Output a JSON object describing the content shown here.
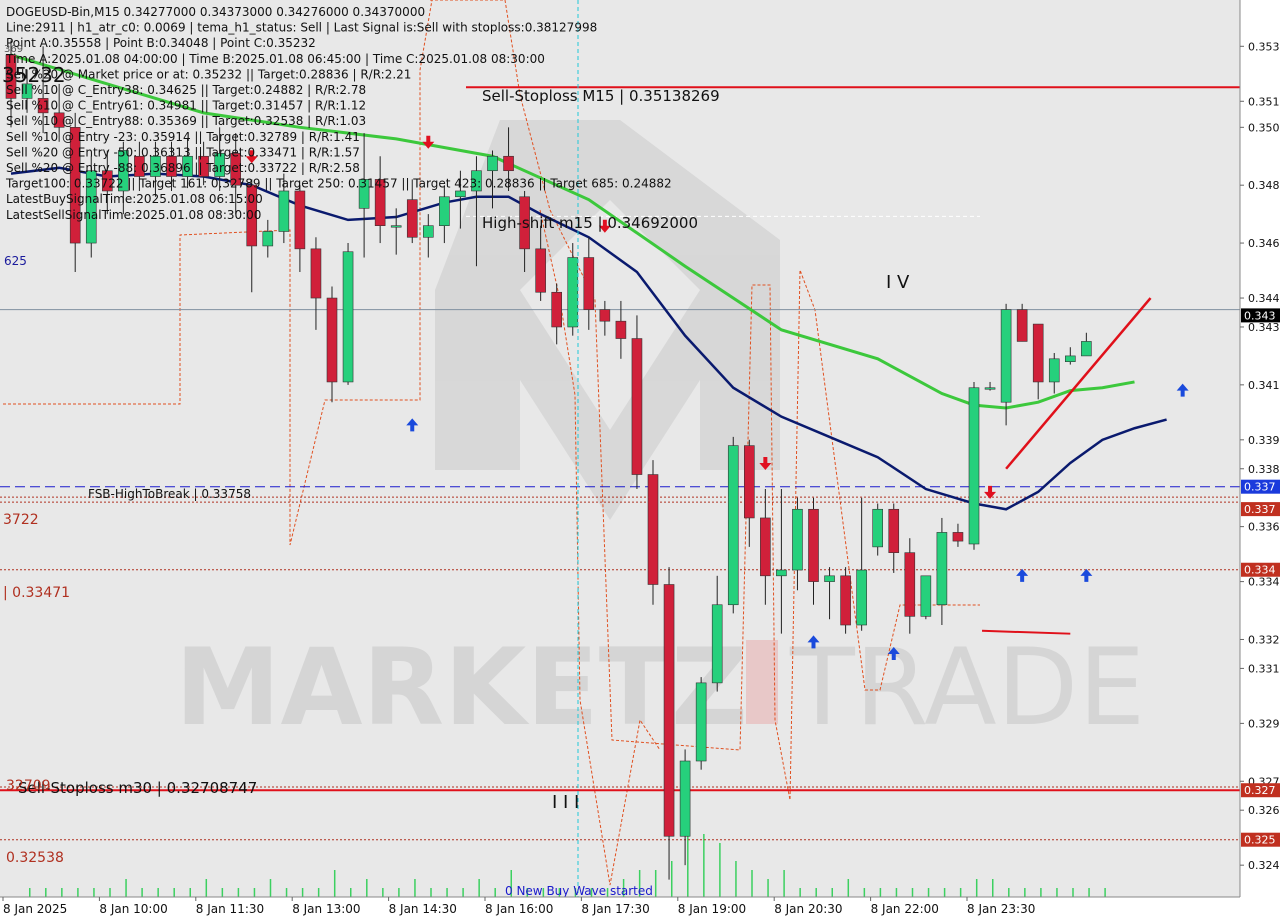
{
  "header": {
    "lines": [
      "DOGEUSD-Bin,M15  0.34277000 0.34373000 0.34276000 0.34370000",
      "Line:2911 | h1_atr_c0: 0.0069 | tema_h1_status: Sell | Last Signal is:Sell with stoploss:0.38127998",
      "Point A:0.35558 | Point B:0.34048 | Point C:0.35232",
      "Time A:2025.01.08 04:00:00 | Time B:2025.01.08 06:45:00 | Time C:2025.01.08 08:30:00",
      "Sell %20 @ Market price or at: 0.35232 || Target:0.28836 | R/R:2.21",
      "Sell %10 @ C_Entry38: 0.34625 || Target:0.24882 | R/R:2.78",
      "Sell %10 @ C_Entry61: 0.34981 || Target:0.31457 | R/R:1.12",
      "Sell %10 @ C_Entry88: 0.35369 || Target:0.32538 | R/R:1.03",
      "Sell %10 @ Entry -23: 0.35914 || Target:0.32789 | R/R:1.41",
      "Sell %20 @ Entry -50: 0.36313 || Target:0.33471 | R/R:1.57",
      "Sell %20 @ Entry -88: 0.36896 || Target:0.33722 | R/R:2.58",
      "Target100: 0.33722 || Target 161: 0.32789 || Target 250: 0.31457 || Target 423: 0.28836 || Target 685: 0.24882",
      "LatestBuySignalTime:2025.01.08 06:15:00",
      "LatestSellSignalTime:2025.01.08 08:30:00"
    ],
    "corner_overlay": "35232",
    "corner_tiny_1": "369",
    "left_edge_label": "625"
  },
  "annotations": {
    "sell_stoploss_m15": "Sell-Stoploss M15 | 0.35138269",
    "high_shift": "High-shift m15 | 0.34692000",
    "fsb_high": "FSB-HighToBreak | 0.33758",
    "sell_stoploss_m30": "Sell-Stoploss m30 | 0.32708747",
    "wave_iv": "I V",
    "wave_iii": "I I I",
    "new_buy_wave": "0 New Buy Wave started",
    "left_3722": "3722",
    "left_33471": "| 0.33471",
    "left_32538": "0.32538",
    "left_32709": "32709"
  },
  "watermark": {
    "left": "MARKETZ",
    "i": "I",
    "right": "TRADE"
  },
  "colors": {
    "bull": "#26d07c",
    "bear": "#d0203a",
    "ma_fast": "#0a1a6e",
    "ma_slow": "#3cc83c",
    "stop_line": "#e0101a",
    "fsb_line": "#1a1acc",
    "dotted_red": "#b03020",
    "envelope": "#e05020",
    "cyan": "#20c8d8",
    "volume": "#3cd060"
  },
  "chart_data": {
    "type": "candlestick",
    "symbol": "DOGEUSD-Bin",
    "timeframe": "M15",
    "ylim": [
      0.3234,
      0.3544
    ],
    "x_ticks": [
      "8 Jan 2025",
      "8 Jan 10:00",
      "8 Jan 11:30",
      "8 Jan 13:00",
      "8 Jan 14:30",
      "8 Jan 16:00",
      "8 Jan 17:30",
      "8 Jan 19:00",
      "8 Jan 20:30",
      "8 Jan 22:00",
      "8 Jan 23:30"
    ],
    "y_ticks": [
      "0.353",
      "0.351",
      "0.350",
      "0.348",
      "0.346",
      "0.344",
      "0.343",
      "0.341",
      "0.339",
      "0.338",
      "0.336",
      "0.334",
      "0.332",
      "0.331",
      "0.329",
      "0.327",
      "0.326",
      "0.324"
    ],
    "price_tags": [
      {
        "label": "0.343",
        "value": 0.3435,
        "style": "current"
      },
      {
        "label": "0.337",
        "value": 0.33758,
        "style": "blue"
      },
      {
        "label": "0.337",
        "value": 0.33722,
        "style": "red"
      },
      {
        "label": "0.334",
        "value": 0.33471,
        "style": "red"
      },
      {
        "label": "0.327",
        "value": 0.32709,
        "style": "red"
      },
      {
        "label": "0.325",
        "value": 0.32538,
        "style": "red"
      }
    ],
    "current_price": 0.3437,
    "levels": {
      "sell_stoploss_m15": 0.35138269,
      "high_shift": 0.34692,
      "fsb_high": 0.33758,
      "t100": 0.33722,
      "t_33471": 0.33471,
      "sell_stoploss_m30": 0.32708747,
      "t_32538": 0.32538
    },
    "candles": [
      [
        0.3525,
        0.353,
        0.35,
        0.351
      ],
      [
        0.351,
        0.352,
        0.3505,
        0.3515
      ],
      [
        0.351,
        0.3528,
        0.3498,
        0.3505
      ],
      [
        0.3505,
        0.3515,
        0.3495,
        0.35
      ],
      [
        0.35,
        0.3505,
        0.345,
        0.346
      ],
      [
        0.346,
        0.349,
        0.3455,
        0.3485
      ],
      [
        0.3485,
        0.3492,
        0.347,
        0.3478
      ],
      [
        0.3478,
        0.3495,
        0.347,
        0.3492
      ],
      [
        0.349,
        0.3495,
        0.3478,
        0.3483
      ],
      [
        0.3483,
        0.3495,
        0.3476,
        0.349
      ],
      [
        0.349,
        0.3495,
        0.3478,
        0.3483
      ],
      [
        0.3483,
        0.3496,
        0.3479,
        0.349
      ],
      [
        0.349,
        0.3495,
        0.348,
        0.3483
      ],
      [
        0.3483,
        0.35,
        0.3478,
        0.3491
      ],
      [
        0.3491,
        0.3498,
        0.347,
        0.348
      ],
      [
        0.348,
        0.3482,
        0.3443,
        0.3459
      ],
      [
        0.3459,
        0.3468,
        0.3455,
        0.3464
      ],
      [
        0.3464,
        0.3484,
        0.346,
        0.3478
      ],
      [
        0.3478,
        0.348,
        0.345,
        0.3458
      ],
      [
        0.3458,
        0.3462,
        0.343,
        0.3441
      ],
      [
        0.3441,
        0.3445,
        0.3405,
        0.3412
      ],
      [
        0.3412,
        0.346,
        0.3411,
        0.3457
      ],
      [
        0.3472,
        0.3498,
        0.3455,
        0.3482
      ],
      [
        0.3482,
        0.349,
        0.346,
        0.3466
      ],
      [
        0.3466,
        0.3472,
        0.3456,
        0.3466
      ],
      [
        0.3475,
        0.3482,
        0.346,
        0.3462
      ],
      [
        0.3462,
        0.347,
        0.3455,
        0.3466
      ],
      [
        0.3466,
        0.348,
        0.346,
        0.3476
      ],
      [
        0.3476,
        0.3485,
        0.3465,
        0.3478
      ],
      [
        0.3478,
        0.349,
        0.3452,
        0.3485
      ],
      [
        0.3485,
        0.3492,
        0.3472,
        0.349
      ],
      [
        0.349,
        0.35,
        0.3478,
        0.3485
      ],
      [
        0.3476,
        0.3478,
        0.345,
        0.3458
      ],
      [
        0.3458,
        0.3466,
        0.344,
        0.3443
      ],
      [
        0.3443,
        0.3446,
        0.3425,
        0.3431
      ],
      [
        0.3431,
        0.346,
        0.3428,
        0.3455
      ],
      [
        0.3455,
        0.3462,
        0.343,
        0.3437
      ],
      [
        0.3437,
        0.344,
        0.3428,
        0.3433
      ],
      [
        0.3433,
        0.344,
        0.342,
        0.3427
      ],
      [
        0.3427,
        0.3435,
        0.3375,
        0.338
      ],
      [
        0.338,
        0.3385,
        0.3335,
        0.3342
      ],
      [
        0.3342,
        0.3348,
        0.324,
        0.3255
      ],
      [
        0.3255,
        0.3285,
        0.3245,
        0.3281
      ],
      [
        0.3281,
        0.331,
        0.3278,
        0.3308
      ],
      [
        0.3308,
        0.3345,
        0.3305,
        0.3335
      ],
      [
        0.3335,
        0.3393,
        0.3332,
        0.339
      ],
      [
        0.339,
        0.3392,
        0.3355,
        0.3365
      ],
      [
        0.3365,
        0.3375,
        0.3335,
        0.3345
      ],
      [
        0.3345,
        0.3375,
        0.3325,
        0.3347
      ],
      [
        0.3347,
        0.3372,
        0.334,
        0.3368
      ],
      [
        0.3368,
        0.3372,
        0.3335,
        0.3343
      ],
      [
        0.3343,
        0.3348,
        0.333,
        0.3345
      ],
      [
        0.3345,
        0.3348,
        0.3325,
        0.3328
      ],
      [
        0.3328,
        0.3372,
        0.3326,
        0.3347
      ],
      [
        0.3355,
        0.337,
        0.3352,
        0.3368
      ],
      [
        0.3368,
        0.337,
        0.3346,
        0.3353
      ],
      [
        0.3353,
        0.3358,
        0.3325,
        0.3331
      ],
      [
        0.3331,
        0.3345,
        0.333,
        0.3345
      ],
      [
        0.3335,
        0.3365,
        0.3328,
        0.336
      ],
      [
        0.336,
        0.3363,
        0.3355,
        0.3357
      ],
      [
        0.3356,
        0.3412,
        0.3354,
        0.341
      ],
      [
        0.341,
        0.3412,
        0.3409,
        0.341
      ],
      [
        0.3405,
        0.3439,
        0.3397,
        0.3437
      ],
      [
        0.3437,
        0.3439,
        0.3426,
        0.3426
      ],
      [
        0.3432,
        0.3432,
        0.3406,
        0.3412
      ],
      [
        0.3412,
        0.3422,
        0.3408,
        0.342
      ],
      [
        0.3419,
        0.3424,
        0.3418,
        0.3421
      ],
      [
        0.3421,
        0.3429,
        0.3421,
        0.3426
      ]
    ],
    "volume": [
      1,
      1,
      1,
      1,
      1,
      1,
      2,
      1,
      1,
      1,
      1,
      2,
      1,
      1,
      1,
      2,
      1,
      1,
      1,
      3,
      1,
      2,
      1,
      1,
      2,
      1,
      1,
      1,
      2,
      1,
      3,
      1,
      1,
      1,
      1,
      1,
      1,
      2,
      3,
      3,
      4,
      9,
      7,
      6,
      4,
      3,
      2,
      3,
      1,
      1,
      1,
      2,
      1,
      1,
      1,
      1,
      1,
      1,
      1,
      2,
      2,
      1,
      1,
      1,
      1,
      1,
      1,
      1
    ],
    "ma_fast": [
      [
        0,
        0.3484
      ],
      [
        3,
        0.3486
      ],
      [
        6,
        0.3483
      ],
      [
        9,
        0.3484
      ],
      [
        12,
        0.3483
      ],
      [
        15,
        0.348
      ],
      [
        18,
        0.3473
      ],
      [
        21,
        0.3468
      ],
      [
        24,
        0.3469
      ],
      [
        27,
        0.3474
      ],
      [
        29,
        0.3476
      ],
      [
        31,
        0.3476
      ],
      [
        33,
        0.347
      ],
      [
        36,
        0.3462
      ],
      [
        39,
        0.345
      ],
      [
        42,
        0.3428
      ],
      [
        45,
        0.341
      ],
      [
        48,
        0.34
      ],
      [
        51,
        0.3393
      ],
      [
        54,
        0.3386
      ],
      [
        57,
        0.3375
      ],
      [
        60,
        0.337
      ],
      [
        62,
        0.3368
      ],
      [
        64,
        0.3374
      ],
      [
        66,
        0.3384
      ],
      [
        68,
        0.3392
      ],
      [
        70,
        0.3396
      ],
      [
        72,
        0.3399
      ]
    ],
    "ma_slow": [
      [
        0,
        0.3525
      ],
      [
        6,
        0.3515
      ],
      [
        12,
        0.3505
      ],
      [
        18,
        0.35
      ],
      [
        24,
        0.3496
      ],
      [
        30,
        0.349
      ],
      [
        36,
        0.3475
      ],
      [
        42,
        0.3452
      ],
      [
        48,
        0.343
      ],
      [
        54,
        0.342
      ],
      [
        58,
        0.3408
      ],
      [
        60,
        0.3404
      ],
      [
        62,
        0.3403
      ],
      [
        64,
        0.3405
      ],
      [
        66,
        0.3409
      ],
      [
        68,
        0.341
      ],
      [
        70,
        0.3412
      ]
    ],
    "signal_arrows": [
      {
        "i": 15,
        "dir": "down",
        "price": 0.349
      },
      {
        "i": 26,
        "dir": "down",
        "price": 0.3495
      },
      {
        "i": 37,
        "dir": "down",
        "price": 0.3466
      },
      {
        "i": 25,
        "dir": "up",
        "price": 0.3397
      },
      {
        "i": 50,
        "dir": "up",
        "price": 0.3322
      },
      {
        "i": 55,
        "dir": "up",
        "price": 0.3318
      },
      {
        "i": 61,
        "dir": "down",
        "price": 0.3374
      },
      {
        "i": 63,
        "dir": "up",
        "price": 0.3345
      },
      {
        "i": 67,
        "dir": "up",
        "price": 0.3345
      },
      {
        "i": 73,
        "dir": "up",
        "price": 0.3409
      },
      {
        "i": 47,
        "dir": "down",
        "price": 0.3384
      }
    ],
    "wave_line": [
      [
        62,
        0.3382
      ],
      [
        71,
        0.3441
      ]
    ],
    "low_line": [
      [
        60.5,
        0.3326
      ],
      [
        66,
        0.3325
      ]
    ]
  }
}
